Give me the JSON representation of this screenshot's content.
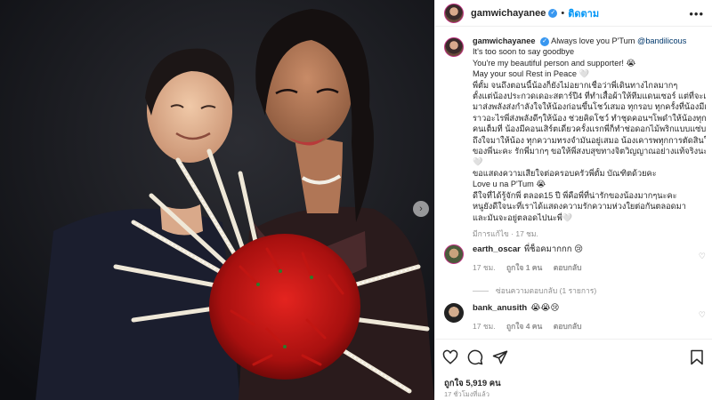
{
  "post": {
    "username": "gamwichayanee",
    "follow_label": "ติดตาม",
    "more_label": "•••",
    "verified_mark": "✓"
  },
  "caption": {
    "username": "gamwichayanee",
    "first_line_text": "Always love you P'Tum",
    "mention": "@bandilicous",
    "lines": [
      "It's too soon to say goodbye",
      "You're my beautiful person and supporter! 😭",
      "May your soul Rest in Peace 🤍",
      "พี่ตั้ม จนถึงตอนนี้น้องก็ยังไม่อยากเชื่อว่าพี่เดินทางไกลมากๆ",
      "ตั้งแต่น้องประกวดเดอะสตาร์ปี4 ที่ทำเสื้อผ้าให้ทีมแดนเซอร์ แต่ที่จะเดิน",
      "มาส่งพลังส่งกำลังใจให้น้องก่อนขึ้นโชว์เสมอ ทุกรอบ ทุกครั้งที่น้องมีเรื่อง",
      "ราวอะไรพี่ส่งพลังดีๆให้น้อง ช่วยคิดโชว์ ทำชุดคอนฯโพดำให้น้องทุกๆ",
      "คนเต็มที่ น้องมีคอนเสิร์ตเดี่ยวครั้งแรกพี่ก็ทำช่อดอกไม้พริกแบบแซ่บ",
      "ถึงใจมาให้น้อง ทุกความทรงจำมันอยู่เสมอ น้องเคารพทุกการตัดสินใจ",
      "ของพี่นะคะ รักพี่มากๆ ขอให้พี่สงบสุขทางจิตวิญญาณอย่างแท้จริงนะคะ",
      "🤍",
      "ขอแสดงความเสียใจต่อครอบครัวพี่ตั้ม บัณฑิตด้วยคะ",
      "Love u na P'Tum 😭",
      "ดีใจที่ได้รู้จักพี่ ตลอด15 ปี พี่คือพี่ที่น่ารักของน้องมากๆนะคะ",
      "หนูยังดีใจนะที่เราได้แสดงความรักความห่วงใยต่อกันตลอดมา",
      "และมันจะอยู่ตลอดไปนะพี่🤍"
    ],
    "edited_meta": "มีการแก้ไข · 17 ชม."
  },
  "comments": [
    {
      "username": "earth_oscar",
      "text": "พี่ช็อคมากกก 😢",
      "time": "17 ชม.",
      "likes": "ถูกใจ 1 คน",
      "reply": "ตอบกลับ"
    },
    {
      "username": "bank_anusith",
      "text": "😭😭😢",
      "time": "17 ชม.",
      "likes": "ถูกใจ 4 คน",
      "reply": "ตอบกลับ"
    }
  ],
  "hide_replies": "ซ่อนความตอบกลับ (1 รายการ)",
  "actions": {
    "likes": "ถูกใจ 5,919 คน",
    "time_ago": "17 ชั่วโมงที่แล้ว"
  },
  "colors": {
    "accent": "#0095f6",
    "verified": "#3897f0",
    "muted": "#8e8e8e"
  },
  "icons": [
    "heart-icon",
    "comment-icon",
    "share-icon",
    "bookmark-icon",
    "chevron-right-icon",
    "more-icon"
  ]
}
